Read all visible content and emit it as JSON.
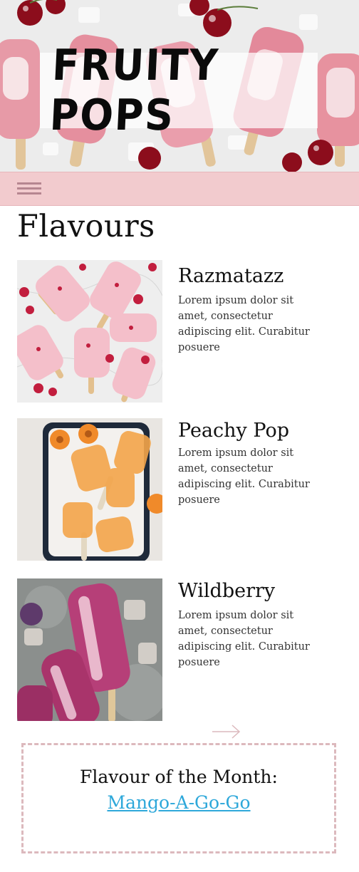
{
  "header": {
    "logo_text": "FRUITY POPS"
  },
  "nav": {
    "menu_icon": "hamburger-menu-icon"
  },
  "flavours": {
    "title": "Flavours",
    "items": [
      {
        "name": "Razmatazz",
        "description": "Lorem ipsum dolor sit amet, consectetur adipiscing elit. Curabitur posuere",
        "image": "raspberry-popsicles-photo"
      },
      {
        "name": "Peachy Pop",
        "description": "Lorem ipsum dolor sit amet, consectetur adipiscing elit. Curabitur posuere",
        "image": "peach-popsicles-photo"
      },
      {
        "name": "Wildberry",
        "description": "Lorem ipsum dolor sit amet, consectetur adipiscing elit. Curabitur posuere",
        "image": "wildberry-popsicles-photo"
      }
    ]
  },
  "pager": {
    "next_icon": "arrow-right-icon"
  },
  "feature": {
    "label": "Flavour of the Month:",
    "link_text": "Mango-A-Go-Go"
  },
  "colors": {
    "nav_background": "#f2cbce",
    "menu_icon": "#b68690",
    "dashed_border": "#dcb9bd",
    "link": "#2ea8da"
  }
}
